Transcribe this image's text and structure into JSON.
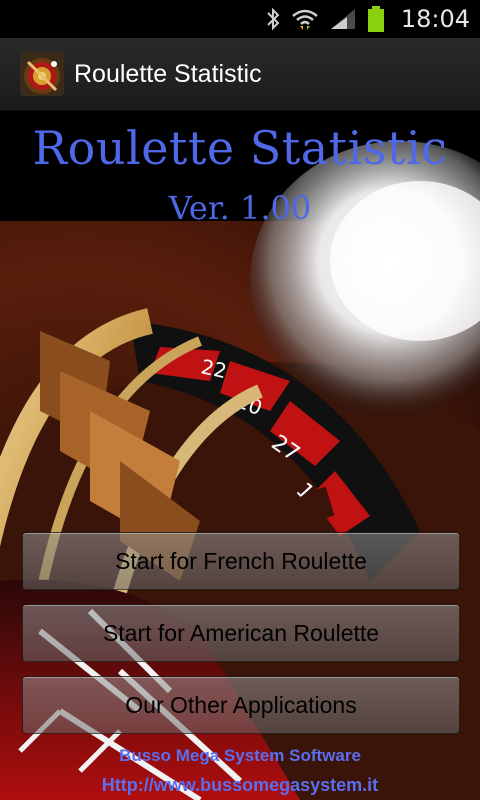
{
  "status_bar": {
    "time": "18:04",
    "icons": [
      "bluetooth-icon",
      "wifi-icon",
      "signal-icon",
      "battery-icon"
    ]
  },
  "app_bar": {
    "title": "Roulette Statistic",
    "icon": "roulette-app-icon"
  },
  "main": {
    "headline": "Roulette Statistic",
    "version": "Ver. 1.00",
    "buttons": [
      {
        "label": "Start for French Roulette"
      },
      {
        "label": "Start for American Roulette"
      },
      {
        "label": "Our Other Applications"
      }
    ],
    "footer": {
      "company": "Busso Mega System Software",
      "url": "Http://www.bussomegasystem.it"
    }
  },
  "colors": {
    "headline": "#4f68e8",
    "footer_text": "#5a6ef0",
    "battery": "#8bd010"
  }
}
